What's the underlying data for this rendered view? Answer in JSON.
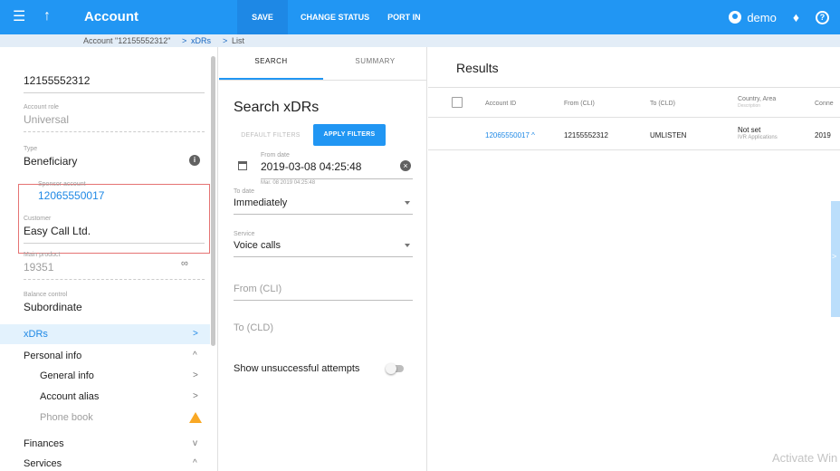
{
  "topbar": {
    "title": "Account",
    "actions": [
      "SAVE",
      "CHANGE STATUS",
      "PORT IN"
    ],
    "user": "demo"
  },
  "breadcrumb": {
    "account": "Account \"12155552312\"",
    "xdrs": "xDRs",
    "list": "List"
  },
  "sidebar": {
    "account_number": "12155552312",
    "account_role_label": "Account role",
    "account_role": "Universal",
    "type_label": "Type",
    "type": "Beneficiary",
    "sponsor_label": "Sponsor account",
    "sponsor": "12065550017",
    "customer_label": "Customer",
    "customer": "Easy Call Ltd.",
    "main_product_label": "Main product",
    "main_product": "19351",
    "balance_control_label": "Balance control",
    "balance_control": "Subordinate",
    "nav": [
      {
        "label": "xDRs",
        "chevron": ">"
      },
      {
        "label": "Personal info",
        "chevron": "^"
      },
      {
        "label": "General info",
        "chevron": ">"
      },
      {
        "label": "Account alias",
        "chevron": ">"
      },
      {
        "label": "Phone book",
        "chevron": ""
      },
      {
        "label": "Finances",
        "chevron": "v"
      },
      {
        "label": "Services",
        "chevron": "^"
      }
    ]
  },
  "search": {
    "tabs": [
      "SEARCH",
      "SUMMARY"
    ],
    "title": "Search xDRs",
    "default_filters": "DEFAULT FILTERS",
    "apply_filters": "APPLY FILTERS",
    "from_date_label": "From date",
    "from_date": "2019-03-08 04:25:48",
    "from_date_hint": "Mar. 08 2019 04:25:48",
    "to_date_label": "To date",
    "to_date": "Immediately",
    "service_label": "Service",
    "service": "Voice calls",
    "from_cli_placeholder": "From (CLI)",
    "to_cld_placeholder": "To (CLD)",
    "toggle_label": "Show unsuccessful attempts"
  },
  "results": {
    "title": "Results",
    "headers": [
      "Account ID",
      "From (CLI)",
      "To (CLD)",
      "Country, Area",
      "Conne"
    ],
    "header_sub": "Description",
    "row": {
      "account_id": "12065550017 ^",
      "from": "12155552312",
      "to": "UMLISTEN",
      "country": "Not set",
      "description": "IVR Applications",
      "connect": "2019"
    },
    "side_handle": ">"
  },
  "watermark": "Activate Win",
  "colors": {
    "primary": "#2196f3",
    "highlight_border": "#e57373",
    "warning": "#f9a825"
  }
}
